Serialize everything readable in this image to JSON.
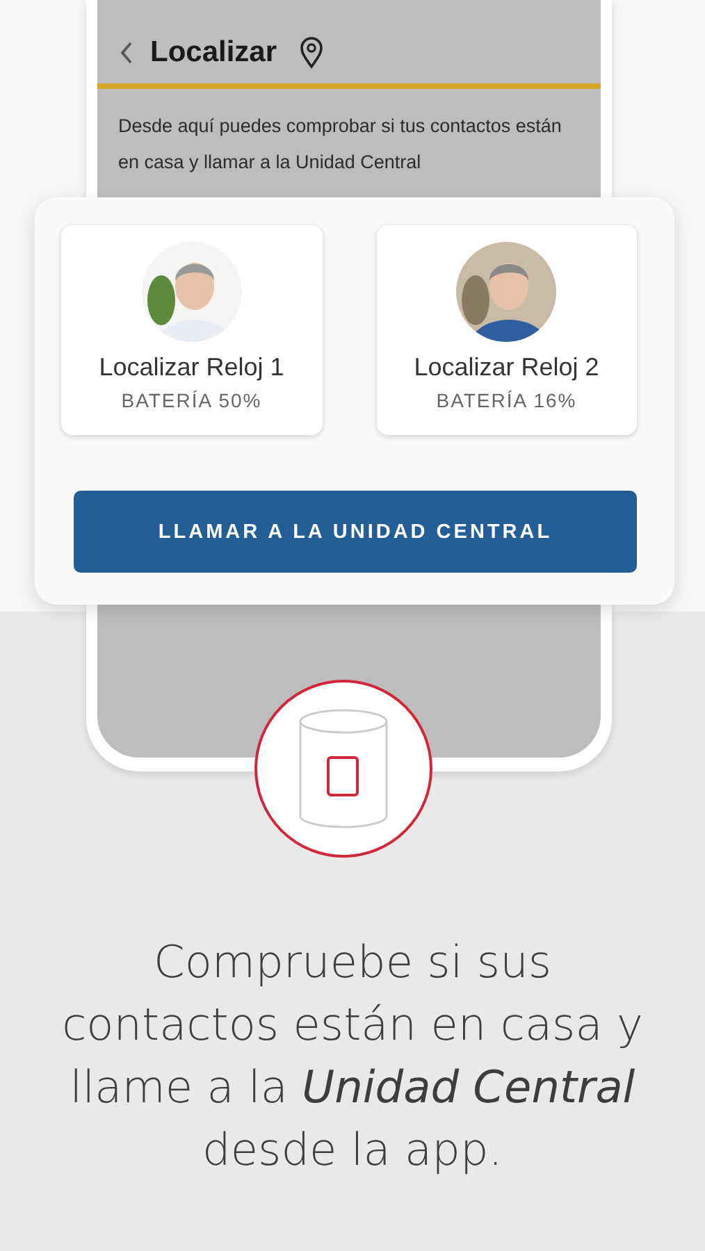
{
  "header": {
    "title": "Localizar"
  },
  "description": "Desde aquí puedes comprobar si tus contactos están en casa y llamar a la Unidad Central",
  "watches": [
    {
      "name": "Localizar Reloj 1",
      "battery": "BATERÍA 50%"
    },
    {
      "name": "Localizar Reloj 2",
      "battery": "BATERÍA 16%"
    }
  ],
  "call_button": "LLAMAR A LA UNIDAD CENTRAL",
  "caption": "Compruebe si sus contactos están en casa y llame a la **Unidad Central**  desde la app."
}
